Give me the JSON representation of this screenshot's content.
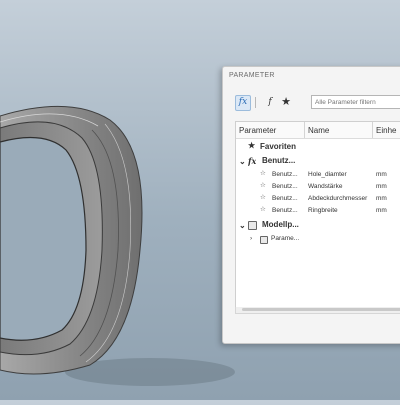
{
  "panel": {
    "title": "PARAMETER",
    "filter_placeholder": "Alle Parameter filtern",
    "toolbar": {
      "fx_icon": "fx",
      "fx_sub_icon": "f",
      "star_icon": "★"
    },
    "columns": [
      "Parameter",
      "Name",
      "Einhe"
    ],
    "favorites_label": "Favoriten",
    "user_group_label": "Benutz...",
    "user_params": [
      {
        "param": "Benutz...",
        "name": "Hole_diamter",
        "unit": "mm"
      },
      {
        "param": "Benutz...",
        "name": "Wandstärke",
        "unit": "mm"
      },
      {
        "param": "Benutz...",
        "name": "Abdeckdurchmesser",
        "unit": "mm"
      },
      {
        "param": "Benutz...",
        "name": "Ringbreite",
        "unit": "mm"
      }
    ],
    "model_group_label": "Modellp...",
    "model_child_label": "Parame..."
  },
  "colors": {
    "accent": "#2a78c8",
    "background_top": "#c4cfd9",
    "ring": "#8e8e8e"
  }
}
